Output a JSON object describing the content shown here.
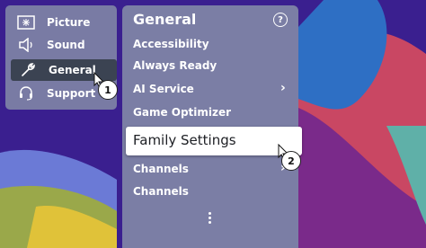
{
  "left_menu": {
    "items": [
      {
        "label": "Picture",
        "icon": "picture-icon"
      },
      {
        "label": "Sound",
        "icon": "speaker-icon"
      },
      {
        "label": "General",
        "icon": "wrench-icon",
        "selected": true
      },
      {
        "label": "Support",
        "icon": "headset-icon"
      }
    ]
  },
  "general_menu": {
    "title": "General",
    "help_icon": "?",
    "items": [
      {
        "label": "Accessibility"
      },
      {
        "label": "Always Ready"
      },
      {
        "label": "AI Service",
        "has_submenu": true
      },
      {
        "label": "Game Optimizer"
      },
      {
        "label": "Family Settings",
        "focused": true
      },
      {
        "label": "Channels",
        "has_submenu": true
      },
      {
        "label": "Channels"
      }
    ]
  },
  "steps": {
    "step1": "1",
    "step2": "2"
  },
  "colors": {
    "background": "#3a1f8f",
    "panel": "#8c96aa",
    "selected_item": "#3b4352",
    "focus_item": "#ffffff"
  }
}
